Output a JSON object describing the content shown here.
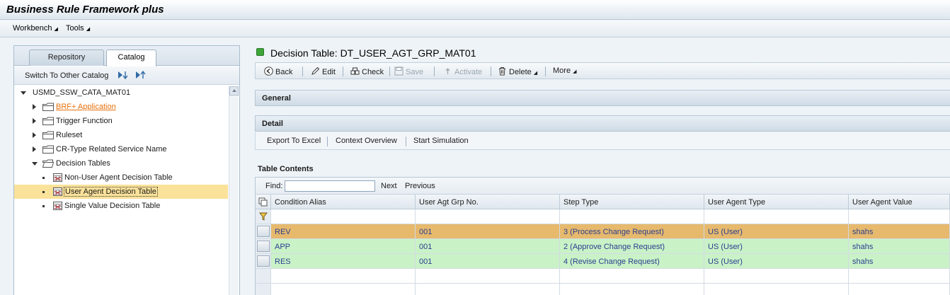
{
  "app": {
    "title": "Business Rule Framework plus"
  },
  "menu": {
    "workbench": "Workbench",
    "tools": "Tools"
  },
  "left": {
    "tabs": {
      "repository": "Repository",
      "catalog": "Catalog"
    },
    "switch_label": "Switch To Other Catalog",
    "tree": {
      "root": "USMD_SSW_CATA_MAT01",
      "brf_app": "BRF+ Application",
      "trigger": "Trigger Function",
      "ruleset": "Ruleset",
      "crtype": "CR-Type Related Service Name",
      "decision_tables": "Decision Tables",
      "non_user": "Non-User Agent Decision Table",
      "user_agent": "User Agent Decision Table",
      "single_value": "Single Value Decision Table"
    }
  },
  "right": {
    "title": "Decision Table: DT_USER_AGT_GRP_MAT01",
    "toolbar": {
      "back": "Back",
      "edit": "Edit",
      "check": "Check",
      "save": "Save",
      "activate": "Activate",
      "delete": "Delete",
      "more": "More"
    },
    "sections": {
      "general": "General",
      "detail": "Detail"
    },
    "detail_actions": {
      "export": "Export To Excel",
      "context": "Context Overview",
      "simulation": "Start Simulation"
    },
    "table": {
      "label": "Table Contents",
      "find_label": "Find:",
      "find_value": "",
      "next": "Next",
      "previous": "Previous",
      "columns": [
        "Condition Alias",
        "User Agt Grp No.",
        "Step Type",
        "User Agent Type",
        "User Agent Value"
      ],
      "rows": [
        [
          "REV",
          "001",
          "3 (Process Change Request)",
          "US (User)",
          "shahs"
        ],
        [
          "APP",
          "001",
          "2 (Approve Change Request)",
          "US (User)",
          "shahs"
        ],
        [
          "RES",
          "001",
          "4 (Revise Change Request)",
          "US (User)",
          "shahs"
        ]
      ]
    }
  },
  "colors": {
    "selected_row": "#e6b96d",
    "valid_row": "#c9f2c7",
    "tree_selection": "#fbe29a",
    "link_orange": "#e7700d",
    "status_green": "#3fa43a"
  }
}
